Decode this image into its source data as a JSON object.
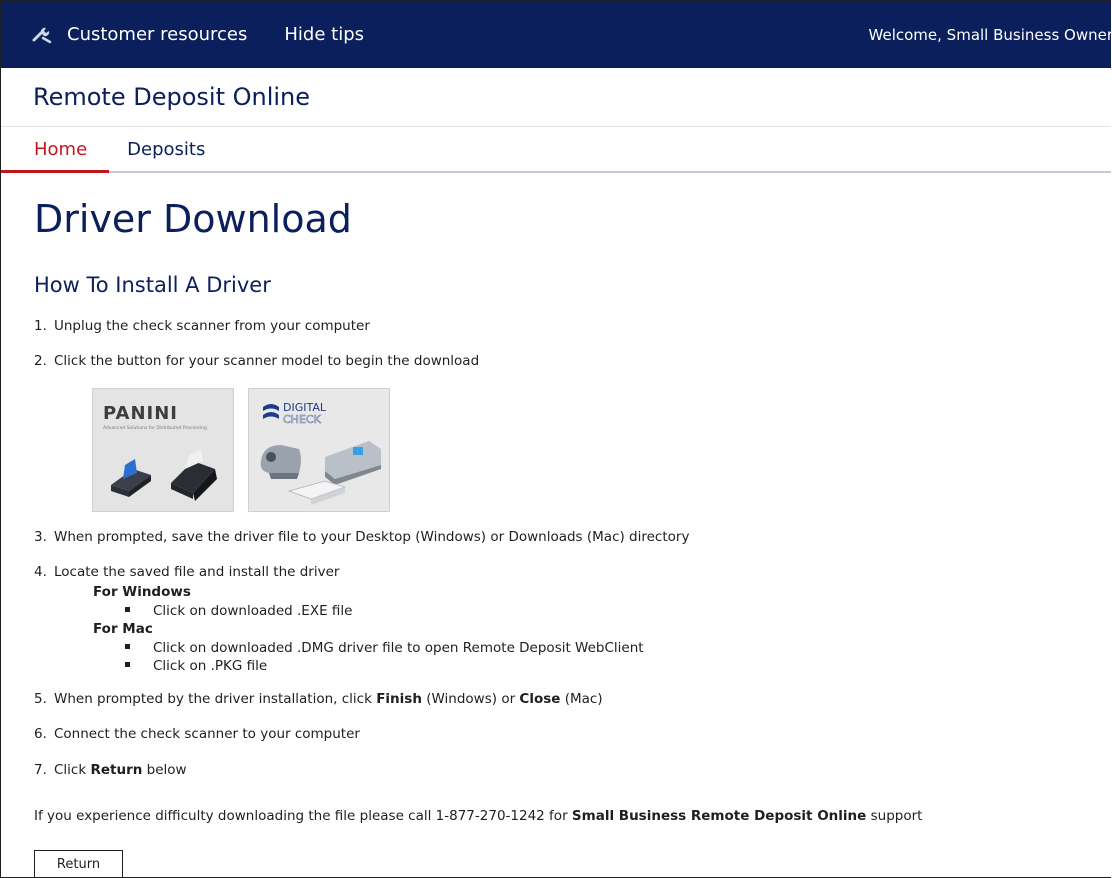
{
  "topbar": {
    "customer_resources": "Customer resources",
    "hide_tips": "Hide tips",
    "welcome": "Welcome, Small Business Owner"
  },
  "app": {
    "title": "Remote Deposit Online"
  },
  "tabs": [
    {
      "label": "Home",
      "active": true
    },
    {
      "label": "Deposits",
      "active": false
    }
  ],
  "page": {
    "title": "Driver Download",
    "section_title": "How To Install A Driver"
  },
  "steps": {
    "s1": {
      "num": "1.",
      "text": "Unplug the check scanner from your computer"
    },
    "s2": {
      "num": "2.",
      "text": "Click the button for your scanner model to begin the download"
    },
    "s3": {
      "num": "3.",
      "text": "When prompted, save the driver file to your Desktop (Windows) or Downloads (Mac) directory"
    },
    "s4": {
      "num": "4.",
      "text": "Locate the saved file and install the driver"
    },
    "s5": {
      "num": "5.",
      "pre": "When prompted by the driver installation, click ",
      "b1": "Finish",
      "mid": " (Windows) or ",
      "b2": "Close",
      "post": " (Mac)"
    },
    "s6": {
      "num": "6.",
      "text": "Connect the check scanner to your computer"
    },
    "s7": {
      "num": "7.",
      "pre": "Click ",
      "b1": "Return",
      "post": " below"
    }
  },
  "install": {
    "windows_head": "For Windows",
    "windows_items": [
      "Click on downloaded .EXE file"
    ],
    "mac_head": "For Mac",
    "mac_items": [
      "Click on downloaded .DMG driver file to open Remote Deposit WebClient",
      "Click on .PKG file"
    ]
  },
  "scanners": {
    "panini": {
      "logo": "PANINI",
      "tagline": "Advanced Solutions for Distributed Processing"
    },
    "digital": {
      "logo_top": "DIGITAL",
      "logo_bottom": "CHECK"
    }
  },
  "support": {
    "pre": "If you experience difficulty downloading the file please call 1-877-270-1242 for ",
    "bold": "Small Business Remote Deposit Online",
    "post": " support"
  },
  "buttons": {
    "return_label": "Return"
  },
  "colors": {
    "navy": "#0a1f5c",
    "accent_red": "#c4151c"
  }
}
